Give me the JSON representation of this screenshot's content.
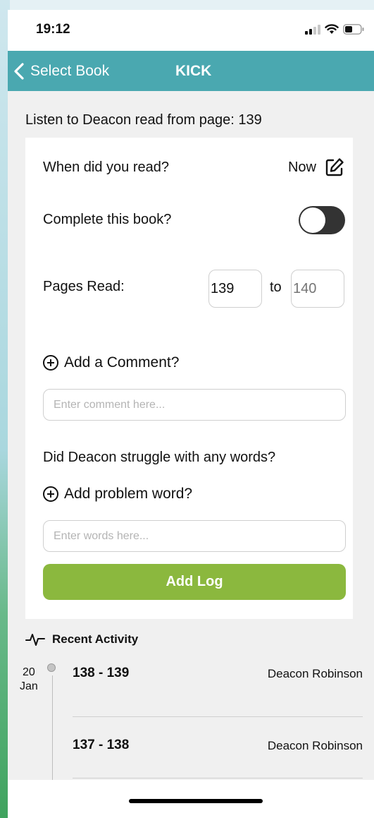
{
  "status_bar": {
    "time": "19:12",
    "icons": [
      "cellular-signal-icon",
      "wifi-icon",
      "battery-icon"
    ]
  },
  "nav": {
    "back_label": "Select Book",
    "title": "KICK"
  },
  "listen_prompt": "Listen to Deacon read from page: 139",
  "form": {
    "when_label": "When did you read?",
    "when_value": "Now",
    "complete_label": "Complete this book?",
    "complete_on": false,
    "pages_label": "Pages Read:",
    "page_from": "139",
    "to_label": "to",
    "page_to_placeholder": "140",
    "add_comment_label": "Add a Comment?",
    "comment_placeholder": "Enter comment here...",
    "struggle_question": "Did Deacon struggle with any words?",
    "add_problem_word_label": "Add problem word?",
    "words_placeholder": "Enter words here...",
    "submit_label": "Add Log"
  },
  "recent_activity": {
    "title": "Recent Activity",
    "date_day": "20",
    "date_month": "Jan",
    "entries": [
      {
        "range": "138 - 139",
        "reader": "Deacon Robinson"
      },
      {
        "range": "137 - 138",
        "reader": "Deacon Robinson"
      }
    ]
  },
  "colors": {
    "nav_bar": "#4aa8b0",
    "submit_button": "#8bb83e",
    "toggle_off": "#333333"
  }
}
